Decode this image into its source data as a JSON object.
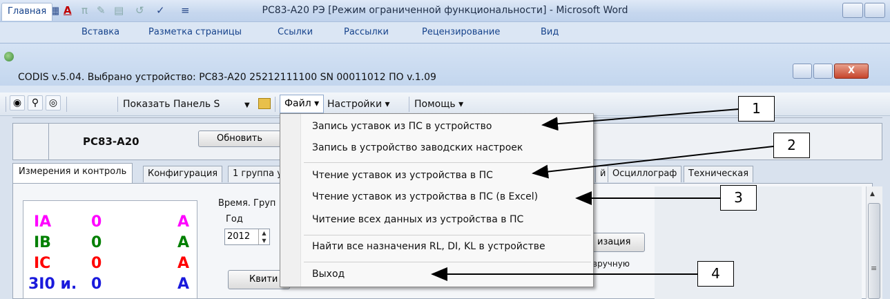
{
  "word": {
    "title": "РС83-А20 РЭ [Режим ограниченной функциональности] - Microsoft Word",
    "tabs": [
      "Главная",
      "Вставка",
      "Разметка страницы",
      "Ссылки",
      "Рассылки",
      "Рецензирование",
      "Вид"
    ]
  },
  "codis": {
    "title": "CODIS v.5.04.  Выбрано устройство:  РС83-А20  25212111100  SN 00011012  ПО v.1.09",
    "toolbar": {
      "show_panel": "Показать Панель S",
      "menu_file": "Файл ▾",
      "menu_settings": "Настройки ▾",
      "menu_help": "Помощь ▾"
    },
    "device_name": "РС83-А20",
    "refresh_label": "Обновить",
    "tabs": [
      "Измерения и контроль",
      "Конфигурация",
      "1 группа у",
      "й",
      "Осциллограф",
      "Техническая"
    ],
    "measurements": [
      {
        "label": "IA",
        "value": "0",
        "unit": "A",
        "color": "#ff00ff"
      },
      {
        "label": "IB",
        "value": "0",
        "unit": "A",
        "color": "#008000"
      },
      {
        "label": "IC",
        "value": "0",
        "unit": "A",
        "color": "#ff0000"
      },
      {
        "label": "3I0 и.",
        "value": "0",
        "unit": "A",
        "color": "#1a1adc"
      }
    ],
    "time_group_label": "Время. Груп",
    "year_label": "Год",
    "year_value": "2012",
    "ack_label": "Квити",
    "sync_label": "изация",
    "manual_label": "вручную"
  },
  "dropdown": {
    "items": [
      "Запись уставок из ПС в устройство",
      "Запись в устройство заводских настроек",
      "Чтение уставок из устройства в ПС",
      "Чтение уставок из устройства в ПС (в Excel)",
      "Читение всех данных из устройства в ПС",
      "Найти все назначения RL, DI, KL в устройстве",
      "Выход"
    ]
  },
  "callouts": [
    "1",
    "2",
    "3",
    "4"
  ]
}
